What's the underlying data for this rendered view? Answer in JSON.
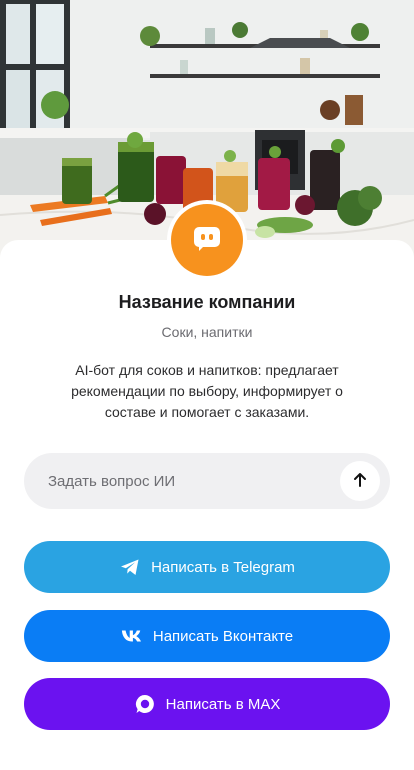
{
  "company": {
    "name": "Название компании",
    "subtitle": "Соки, напитки",
    "description": "AI-бот для соков и напитков: предлагает рекомендации по выбору, информирует о составе и помогает с заказами."
  },
  "ask": {
    "placeholder": "Задать вопрос ИИ"
  },
  "buttons": {
    "telegram": "Написать в Telegram",
    "vk": "Написать Вконтакте",
    "max": "Написать в MAX"
  },
  "colors": {
    "avatar": "#f7921e",
    "telegram": "#2aa3e2",
    "vk": "#0a7df5",
    "max": "#6b12f0"
  },
  "icons": {
    "avatar": "chat-bot-icon",
    "send": "arrow-up-icon",
    "telegram": "telegram-icon",
    "vk": "vk-icon",
    "max": "max-icon"
  }
}
